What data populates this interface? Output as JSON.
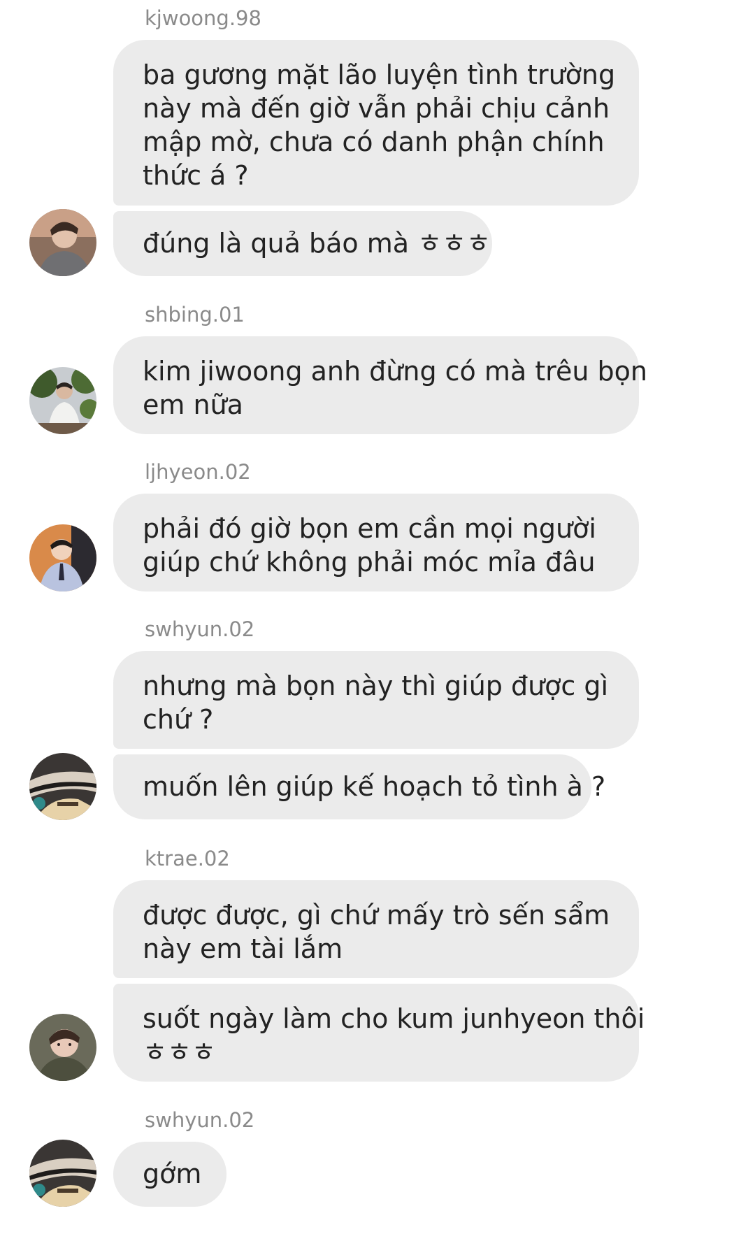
{
  "messages": [
    {
      "username": "kjwoong.98",
      "bubbles": [
        {
          "lines": [
            "ba gương mặt lão luyện tình trường",
            "này mà đến giờ vẫn phải chịu cảnh",
            "mập mờ, chưa có danh phận chính",
            "thức á ?"
          ]
        },
        {
          "lines": [
            "đúng là quả báo mà ㅎㅎㅎ"
          ]
        }
      ]
    },
    {
      "username": "shbing.01",
      "bubbles": [
        {
          "lines": [
            "kim jiwoong anh đừng có mà trêu bọn",
            "em nữa"
          ]
        }
      ]
    },
    {
      "username": "ljhyeon.02",
      "bubbles": [
        {
          "lines": [
            "phải đó giờ bọn em cần mọi người",
            "giúp chứ không phải móc mỉa đâu"
          ]
        }
      ]
    },
    {
      "username": "swhyun.02",
      "bubbles": [
        {
          "lines": [
            "nhưng mà bọn này thì giúp được gì",
            "chứ ?"
          ]
        },
        {
          "lines": [
            "muốn lên giúp kế hoạch tỏ tình à ?"
          ]
        }
      ]
    },
    {
      "username": "ktrae.02",
      "bubbles": [
        {
          "lines": [
            "được được, gì chứ mấy trò sến sẩm",
            "này em tài lắm"
          ]
        },
        {
          "lines": [
            "suốt ngày làm cho kum junhyeon thôi",
            "ㅎㅎㅎ"
          ]
        }
      ]
    },
    {
      "username": "swhyun.02",
      "bubbles": [
        {
          "lines": [
            "gớm"
          ]
        }
      ]
    }
  ],
  "colors": {
    "bubble_bg": "#ebebeb",
    "text": "#222222",
    "username": "#8a8a8a",
    "background": "#ffffff"
  }
}
